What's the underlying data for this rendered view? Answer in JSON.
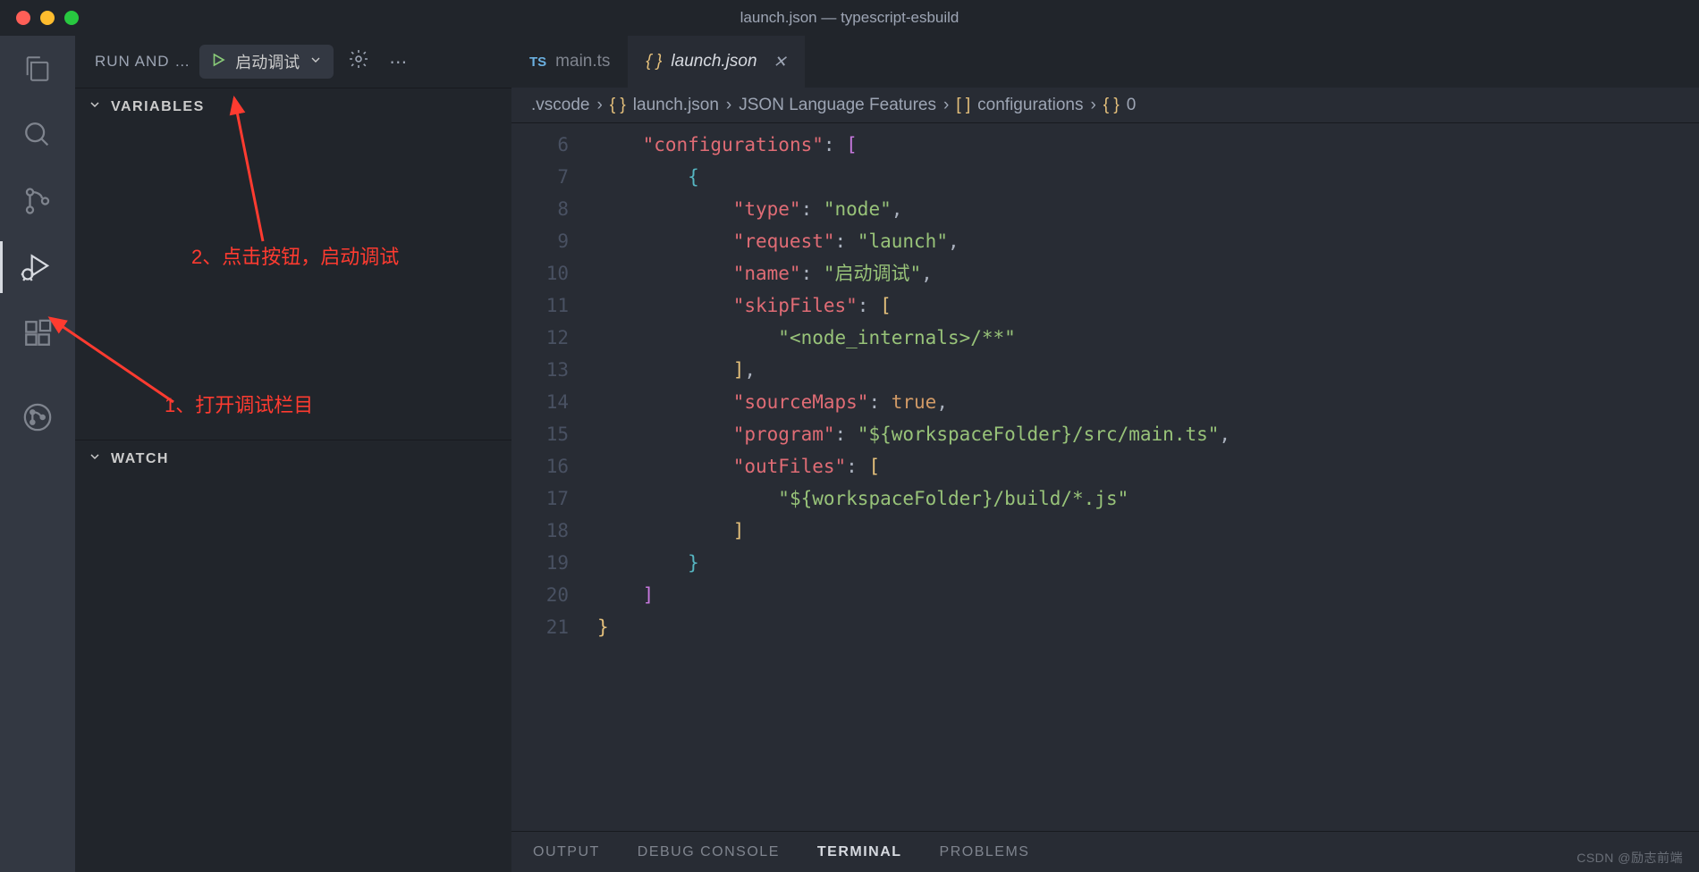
{
  "window": {
    "title": "launch.json — typescript-esbuild"
  },
  "sidebar": {
    "title": "RUN AND …",
    "run_button_label": "启动调试",
    "sections": {
      "variables": "VARIABLES",
      "watch": "WATCH"
    }
  },
  "annotations": {
    "step1": "1、打开调试栏目",
    "step2": "2、点击按钮，启动调试"
  },
  "tabs": [
    {
      "icon": "TS",
      "label": "main.ts",
      "active": false
    },
    {
      "icon": "{ }",
      "label": "launch.json",
      "active": true
    }
  ],
  "breadcrumbs": [
    {
      "icon": "",
      "label": ".vscode"
    },
    {
      "icon": "{ }",
      "label": "launch.json"
    },
    {
      "icon": "",
      "label": "JSON Language Features"
    },
    {
      "icon": "[ ]",
      "label": "configurations"
    },
    {
      "icon": "{ }",
      "label": "0"
    }
  ],
  "editor": {
    "line_start": 6,
    "line_end": 21,
    "code": {
      "l6": {
        "indent": 1,
        "tokens": [
          [
            "key",
            "\"configurations\""
          ],
          [
            "punc",
            ": "
          ],
          [
            "brace-p",
            "["
          ]
        ]
      },
      "l7": {
        "indent": 2,
        "tokens": [
          [
            "brace-b",
            "{"
          ]
        ]
      },
      "l8": {
        "indent": 3,
        "tokens": [
          [
            "key",
            "\"type\""
          ],
          [
            "punc",
            ": "
          ],
          [
            "str",
            "\"node\""
          ],
          [
            "punc",
            ","
          ]
        ]
      },
      "l9": {
        "indent": 3,
        "tokens": [
          [
            "key",
            "\"request\""
          ],
          [
            "punc",
            ": "
          ],
          [
            "str",
            "\"launch\""
          ],
          [
            "punc",
            ","
          ]
        ]
      },
      "l10": {
        "indent": 3,
        "tokens": [
          [
            "key",
            "\"name\""
          ],
          [
            "punc",
            ": "
          ],
          [
            "str",
            "\"启动调试\""
          ],
          [
            "punc",
            ","
          ]
        ]
      },
      "l11": {
        "indent": 3,
        "tokens": [
          [
            "key",
            "\"skipFiles\""
          ],
          [
            "punc",
            ": "
          ],
          [
            "brace-y",
            "["
          ]
        ]
      },
      "l12": {
        "indent": 4,
        "tokens": [
          [
            "str",
            "\"<node_internals>/**\""
          ]
        ]
      },
      "l13": {
        "indent": 3,
        "tokens": [
          [
            "brace-y",
            "]"
          ],
          [
            "punc",
            ","
          ]
        ]
      },
      "l14": {
        "indent": 3,
        "tokens": [
          [
            "key",
            "\"sourceMaps\""
          ],
          [
            "punc",
            ": "
          ],
          [
            "bool",
            "true"
          ],
          [
            "punc",
            ","
          ]
        ]
      },
      "l15": {
        "indent": 3,
        "tokens": [
          [
            "key",
            "\"program\""
          ],
          [
            "punc",
            ": "
          ],
          [
            "str",
            "\"${workspaceFolder}/src/main.ts\""
          ],
          [
            "punc",
            ","
          ]
        ]
      },
      "l16": {
        "indent": 3,
        "tokens": [
          [
            "key",
            "\"outFiles\""
          ],
          [
            "punc",
            ": "
          ],
          [
            "brace-y",
            "["
          ]
        ]
      },
      "l17": {
        "indent": 4,
        "tokens": [
          [
            "str",
            "\"${workspaceFolder}/build/*.js\""
          ]
        ]
      },
      "l18": {
        "indent": 3,
        "tokens": [
          [
            "brace-y",
            "]"
          ]
        ]
      },
      "l19": {
        "indent": 2,
        "tokens": [
          [
            "brace-b",
            "}"
          ]
        ]
      },
      "l20": {
        "indent": 1,
        "tokens": [
          [
            "brace-p",
            "]"
          ]
        ]
      },
      "l21": {
        "indent": 0,
        "tokens": [
          [
            "brace-y",
            "}"
          ]
        ]
      }
    }
  },
  "bottom_panel": {
    "tabs": [
      "OUTPUT",
      "DEBUG CONSOLE",
      "TERMINAL",
      "PROBLEMS"
    ],
    "active": "TERMINAL"
  },
  "watermark": "CSDN @励志前端"
}
